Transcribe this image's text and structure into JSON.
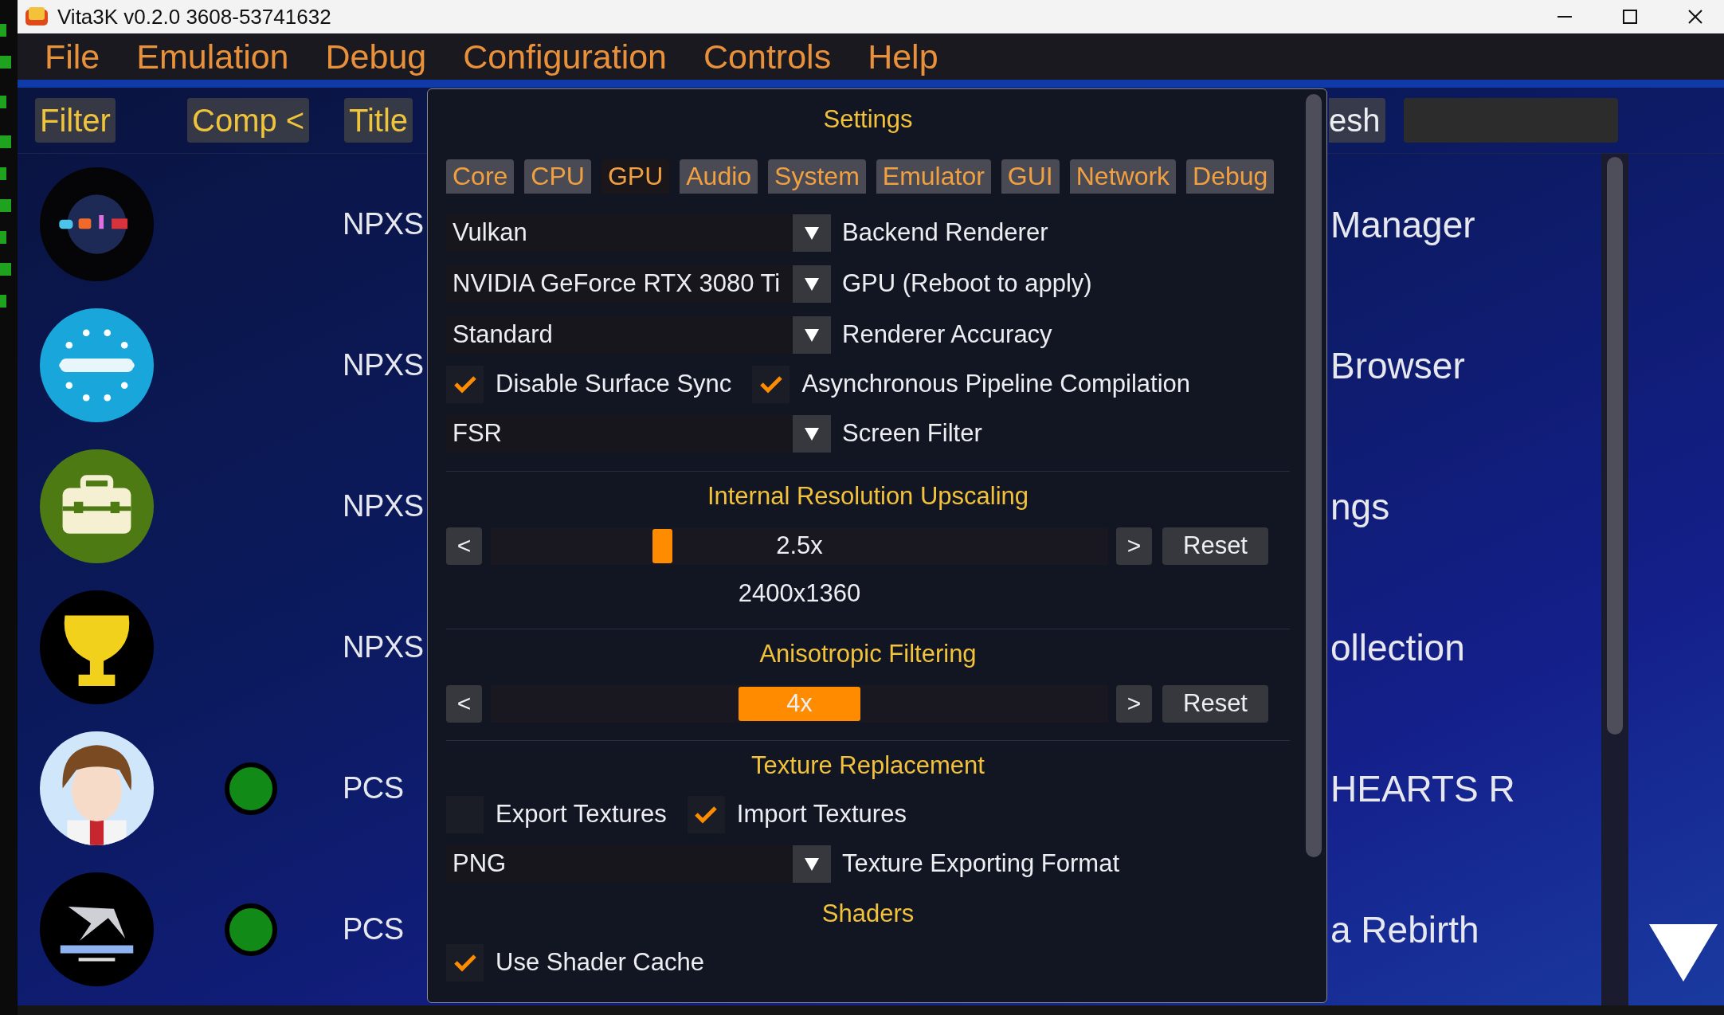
{
  "window": {
    "title": "Vita3K v0.2.0 3608-53741632"
  },
  "menu": [
    {
      "label": "File"
    },
    {
      "label": "Emulation"
    },
    {
      "label": "Debug"
    },
    {
      "label": "Configuration"
    },
    {
      "label": "Controls"
    },
    {
      "label": "Help"
    }
  ],
  "toolbar": {
    "buttons": [
      {
        "label": "Filter"
      },
      {
        "label": "Comp <"
      },
      {
        "label": "Title"
      }
    ],
    "refresh": "esh"
  },
  "games": [
    {
      "kind": "media",
      "compatible": false,
      "title_id": "NPXS",
      "name": "Manager"
    },
    {
      "kind": "globe",
      "compatible": false,
      "title_id": "NPXS",
      "name": "Browser"
    },
    {
      "kind": "toolbox",
      "compatible": false,
      "title_id": "NPXS",
      "name": "ngs"
    },
    {
      "kind": "trophy",
      "compatible": false,
      "title_id": "NPXS",
      "name": "ollection"
    },
    {
      "kind": "picture",
      "compatible": true,
      "color": "#128a18",
      "title_id": "PCS",
      "name": "HEARTS R"
    },
    {
      "kind": "picture",
      "compatible": true,
      "color": "#128a18",
      "title_id": "PCS",
      "name": "a Rebirth"
    }
  ],
  "settings": {
    "title": "Settings",
    "tabs": [
      {
        "label": "Core",
        "selected": false
      },
      {
        "label": "CPU",
        "selected": false
      },
      {
        "label": "GPU",
        "selected": true
      },
      {
        "label": "Audio",
        "selected": false
      },
      {
        "label": "System",
        "selected": false
      },
      {
        "label": "Emulator",
        "selected": false
      },
      {
        "label": "GUI",
        "selected": false
      },
      {
        "label": "Network",
        "selected": false
      },
      {
        "label": "Debug",
        "selected": false
      }
    ],
    "items": [
      {
        "kind": "combo",
        "value": "Vulkan",
        "label": "Backend Renderer"
      },
      {
        "kind": "combo",
        "value": "NVIDIA GeForce RTX 3080 Ti",
        "label": "GPU (Reboot to apply)"
      },
      {
        "kind": "combo",
        "value": "Standard",
        "label": "Renderer Accuracy"
      },
      {
        "kind": "checks",
        "checks": [
          {
            "label": "Disable Surface Sync",
            "checked": true
          },
          {
            "label": "Asynchronous Pipeline Compilation",
            "checked": true
          }
        ]
      },
      {
        "kind": "combo",
        "value": "FSR",
        "label": "Screen Filter"
      },
      {
        "kind": "divider"
      },
      {
        "kind": "heading",
        "text": "Internal Resolution Upscaling"
      },
      {
        "kind": "slider",
        "prev": "<",
        "next": ">",
        "reset": "Reset",
        "value": "2.5x",
        "value_in_thumb": false,
        "level": 0.27
      },
      {
        "kind": "text",
        "text": "2400x1360"
      },
      {
        "kind": "divider"
      },
      {
        "kind": "heading",
        "text": "Anisotropic Filtering"
      },
      {
        "kind": "slider",
        "prev": "<",
        "next": ">",
        "reset": "Reset",
        "value": "4x",
        "value_in_thumb": true,
        "level": 0.5
      },
      {
        "kind": "divider"
      },
      {
        "kind": "heading",
        "text": "Texture Replacement"
      },
      {
        "kind": "checks",
        "checks": [
          {
            "label": "Export Textures",
            "checked": false
          },
          {
            "label": "Import Textures",
            "checked": true
          }
        ]
      },
      {
        "kind": "combo",
        "value": "PNG",
        "label": "Texture Exporting Format"
      },
      {
        "kind": "heading",
        "text": "Shaders"
      },
      {
        "kind": "checks",
        "checks": [
          {
            "label": "Use Shader Cache",
            "checked": true
          }
        ]
      }
    ]
  }
}
